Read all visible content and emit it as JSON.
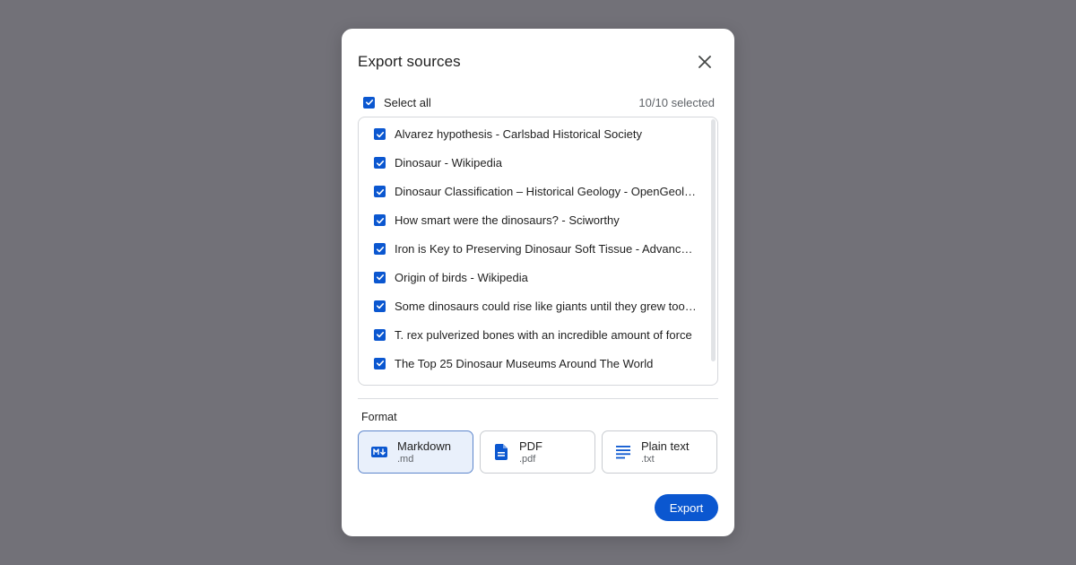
{
  "dialog": {
    "title": "Export sources",
    "select_all_label": "Select all",
    "selected_count": "10/10 selected",
    "format_label": "Format",
    "export_label": "Export"
  },
  "sources": [
    {
      "label": "Alvarez hypothesis - Carlsbad Historical Society",
      "checked": true
    },
    {
      "label": "Dinosaur - Wikipedia",
      "checked": true
    },
    {
      "label": "Dinosaur Classification – Historical Geology - OpenGeology",
      "checked": true
    },
    {
      "label": "How smart were the dinosaurs? - Sciworthy",
      "checked": true
    },
    {
      "label": "Iron is Key to Preserving Dinosaur Soft Tissue - Advanced Photon Source",
      "checked": true
    },
    {
      "label": "Origin of birds - Wikipedia",
      "checked": true
    },
    {
      "label": "Some dinosaurs could rise like giants until they grew too heavy",
      "checked": true
    },
    {
      "label": "T. rex pulverized bones with an incredible amount of force",
      "checked": true
    },
    {
      "label": "The Top 25 Dinosaur Museums Around The World",
      "checked": true
    }
  ],
  "formats": [
    {
      "name": "Markdown",
      "ext": ".md",
      "icon": "markdown-icon",
      "selected": true
    },
    {
      "name": "PDF",
      "ext": ".pdf",
      "icon": "document-icon",
      "selected": false
    },
    {
      "name": "Plain text",
      "ext": ".txt",
      "icon": "text-lines-icon",
      "selected": false
    }
  ],
  "colors": {
    "accent": "#0b57d0",
    "backdrop": "#727178",
    "selected_format_bg": "#e9f0fb"
  }
}
